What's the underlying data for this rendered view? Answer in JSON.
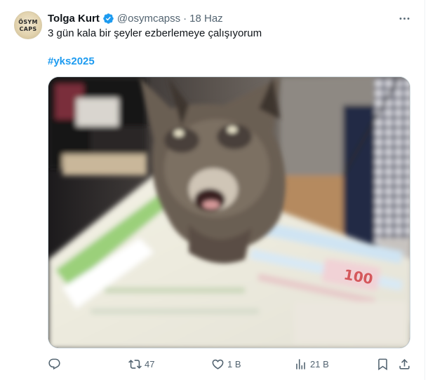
{
  "tweet": {
    "author": {
      "name": "Tolga Kurt",
      "handle": "@osymcapss",
      "verified": true,
      "avatar_logo_top": "ÖSYM",
      "avatar_logo_bottom": "CAPS"
    },
    "separator": "·",
    "date": "18 Haz",
    "text": "3 gün kala bir şeyler ezberlemeye çalışıyorum",
    "hashtag": "#yks2025",
    "media": {
      "description_icon": "photo",
      "sticker_price": "100"
    },
    "stats": {
      "retweets": "47",
      "likes": "1 B",
      "views": "21 B"
    }
  },
  "colors": {
    "verified": "#1d9bf0",
    "hashtag": "#1d9bf0",
    "secondary_text": "#536471",
    "border": "#cfd9de"
  },
  "icons": {
    "more": "more-horizontal-icon",
    "reply": "reply-icon",
    "retweet": "retweet-icon",
    "like": "heart-icon",
    "views": "analytics-icon",
    "bookmark": "bookmark-icon",
    "share": "share-icon"
  }
}
